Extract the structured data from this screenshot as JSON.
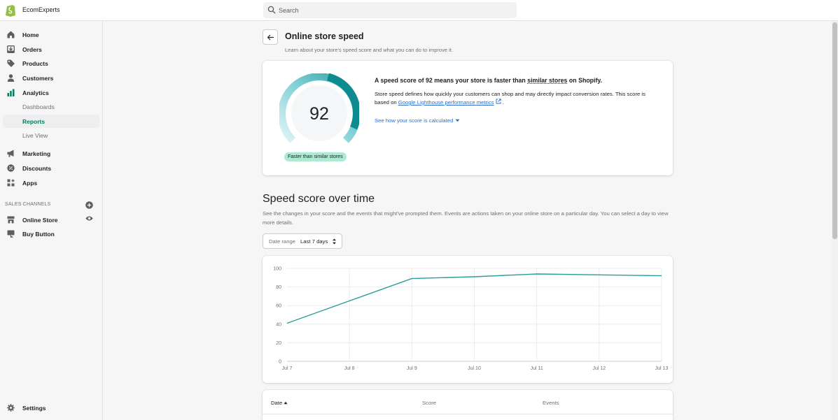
{
  "topbar": {
    "store_name": "EcomExperts",
    "search_placeholder": "Search"
  },
  "sidebar": {
    "items": [
      {
        "label": "Home",
        "icon": "home-icon"
      },
      {
        "label": "Orders",
        "icon": "orders-icon"
      },
      {
        "label": "Products",
        "icon": "tag-icon"
      },
      {
        "label": "Customers",
        "icon": "person-icon"
      },
      {
        "label": "Analytics",
        "icon": "bar-chart-icon"
      },
      {
        "label": "Dashboards"
      },
      {
        "label": "Reports"
      },
      {
        "label": "Live View"
      },
      {
        "label": "Marketing",
        "icon": "megaphone-icon"
      },
      {
        "label": "Discounts",
        "icon": "discount-icon"
      },
      {
        "label": "Apps",
        "icon": "apps-icon"
      }
    ],
    "sales_channels_title": "SALES CHANNELS",
    "channels": [
      {
        "label": "Online Store",
        "icon": "store-icon"
      },
      {
        "label": "Buy Button",
        "icon": "buy-button-icon"
      }
    ],
    "settings_label": "Settings"
  },
  "page": {
    "title": "Online store speed",
    "subtitle": "Learn about your store's speed score and what you can do to improve it."
  },
  "score_card": {
    "score": "92",
    "score_value": 92,
    "badge": "Faster than similar stores",
    "headline_a": "A speed score of 92 means your store is faster than ",
    "headline_link": "similar stores",
    "headline_b": " on Shopify.",
    "description": "Store speed defines how quickly your customers can shop and may directly impact conversion rates. This score is based on ",
    "lighthouse_link": "Google Lighthouse performance metrics",
    "description_end": " .",
    "see_how": "See how your score is calculated"
  },
  "over_time": {
    "heading": "Speed score over time",
    "description": "See the changes in your score and the events that might've prompted them. Events are actions taken on your online store on a particular day. You can select a day to view more details.",
    "date_range_label": "Date range",
    "date_range_value": "Last 7 days"
  },
  "chart_data": {
    "type": "line",
    "x": [
      "Jul 7",
      "Jul 8",
      "Jul 9",
      "Jul 10",
      "Jul 11",
      "Jul 12",
      "Jul 13"
    ],
    "series": [
      {
        "values": [
          41,
          65,
          89,
          91,
          94,
          93,
          92
        ]
      }
    ],
    "ylim": [
      0,
      100
    ],
    "yticks": [
      0,
      20,
      40,
      60,
      80,
      100
    ],
    "grid": true,
    "color": "#2a9d9a"
  },
  "table": {
    "headers": [
      "Date",
      "Score",
      "Events"
    ]
  },
  "colors": {
    "accent": "#008060",
    "teal": "#2a9d9a",
    "badge_bg": "#aee9d1",
    "link": "#2c6ecb"
  }
}
